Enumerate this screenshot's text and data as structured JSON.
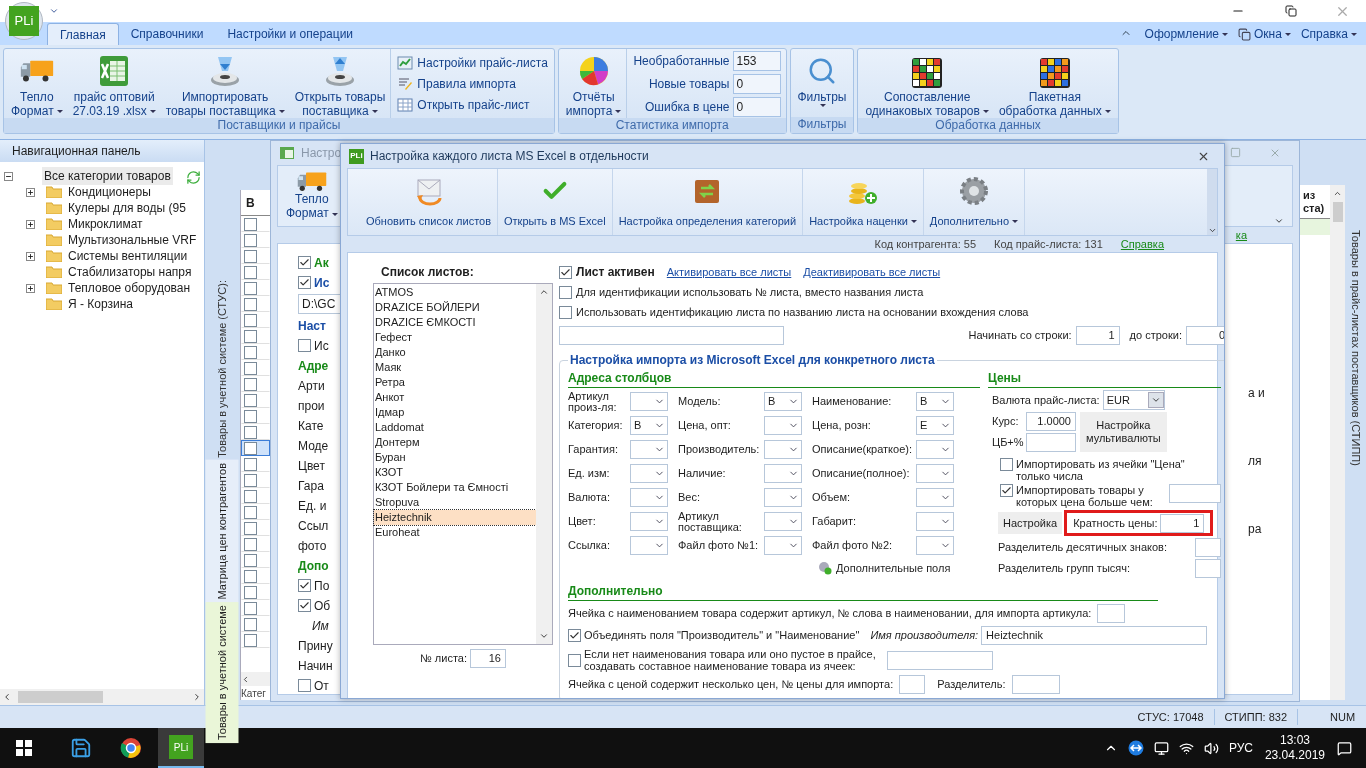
{
  "app": {
    "logo": "PLi"
  },
  "ribbon": {
    "tabs": [
      {
        "label": "Главная",
        "selected": true
      },
      {
        "label": "Справочники",
        "selected": false
      },
      {
        "label": "Настройки и операции",
        "selected": false
      }
    ],
    "right_menu": [
      "Оформление",
      "Окна",
      "Справка"
    ],
    "groups": [
      {
        "title": "Поставщики и прайсы",
        "items": [
          {
            "kind": "large",
            "lines": [
              "Тепло",
              "Формат"
            ]
          },
          {
            "kind": "large",
            "lines": [
              "прайс оптовий",
              "27.03.19  .xlsx"
            ]
          },
          {
            "kind": "large",
            "lines": [
              "Импортировать",
              "товары поставщика"
            ]
          },
          {
            "kind": "large",
            "lines": [
              "Открыть товары",
              "поставщика"
            ]
          },
          {
            "kind": "small",
            "entries": [
              "Настройки прайс-листа",
              "Правила импорта",
              "Открыть прайс-лист"
            ]
          }
        ]
      },
      {
        "title": "Статистика импорта",
        "items": [
          {
            "kind": "large",
            "lines": [
              "Отчёты",
              "импорта"
            ]
          },
          {
            "kind": "stats",
            "rows": [
              {
                "label": "Необработанные",
                "value": "153"
              },
              {
                "label": "Новые товары",
                "value": "0"
              },
              {
                "label": "Ошибка в цене",
                "value": "0"
              }
            ]
          }
        ]
      },
      {
        "title": "Фильтры",
        "items": [
          {
            "kind": "large",
            "lines": [
              "Фильтры"
            ]
          }
        ]
      },
      {
        "title": "Обработка данных",
        "items": [
          {
            "kind": "large",
            "lines": [
              "Сопоставление",
              "одинаковых товаров"
            ]
          },
          {
            "kind": "large",
            "lines": [
              "Пакетная",
              "обработка данных"
            ]
          }
        ]
      }
    ]
  },
  "nav": {
    "title": "Навигационная панель",
    "tree": [
      {
        "label": "Все категории товаров",
        "kind": "group",
        "expanded": true,
        "selected": true,
        "children": [
          {
            "label": "Кондиционеры",
            "kind": "group",
            "expanded": false,
            "selected": false
          },
          {
            "label": "Кулеры для воды (95",
            "kind": "leaf",
            "selected": false
          },
          {
            "label": "Микроклимат",
            "kind": "group",
            "expanded": false,
            "selected": false
          },
          {
            "label": "Мультизональные VRF",
            "kind": "leaf",
            "selected": false
          },
          {
            "label": "Системы вентиляции",
            "kind": "group",
            "expanded": false,
            "selected": false
          },
          {
            "label": "Стабилизаторы напря",
            "kind": "leaf",
            "selected": false
          },
          {
            "label": "Тепловое оборудован",
            "kind": "group",
            "expanded": false,
            "selected": false
          },
          {
            "label": "Я - Корзина",
            "kind": "leaf",
            "selected": false
          }
        ]
      }
    ]
  },
  "side_tabs": {
    "caption": "Товары в учетной системе (СТУС):",
    "tabs": [
      {
        "label": "Матрица цен контрагентов",
        "selected": false
      },
      {
        "label": "Товары в учетной системе",
        "selected": true
      }
    ]
  },
  "grid": {
    "header": "В",
    "footer": "Катег",
    "rows": [
      {
        "checked": false,
        "selected": false
      },
      {
        "checked": false,
        "selected": false
      },
      {
        "checked": false,
        "selected": false
      },
      {
        "checked": false,
        "selected": false
      },
      {
        "checked": false,
        "selected": false
      },
      {
        "checked": false,
        "selected": false
      },
      {
        "checked": false,
        "selected": false
      },
      {
        "checked": false,
        "selected": false
      },
      {
        "checked": false,
        "selected": false
      },
      {
        "checked": false,
        "selected": false
      },
      {
        "checked": false,
        "selected": false
      },
      {
        "checked": false,
        "selected": false
      },
      {
        "checked": false,
        "selected": false
      },
      {
        "checked": false,
        "selected": false
      },
      {
        "checked": false,
        "selected": true
      },
      {
        "checked": false,
        "selected": false
      },
      {
        "checked": false,
        "selected": false
      },
      {
        "checked": false,
        "selected": false
      },
      {
        "checked": false,
        "selected": false
      },
      {
        "checked": false,
        "selected": false
      },
      {
        "checked": false,
        "selected": false
      },
      {
        "checked": false,
        "selected": false
      },
      {
        "checked": false,
        "selected": false
      },
      {
        "checked": false,
        "selected": false
      },
      {
        "checked": false,
        "selected": false
      },
      {
        "checked": false,
        "selected": false
      },
      {
        "checked": false,
        "selected": false
      }
    ]
  },
  "right_panel": {
    "caption": "Товары в прайс-листах поставщиков (СТИПП)",
    "header_lines": [
      "из",
      "ста)"
    ]
  },
  "back_window": {
    "title": "Настро",
    "toolbar_lines": [
      "Тепло",
      "Формат"
    ],
    "right_link": "ка",
    "fragments": [
      {
        "kind": "check",
        "text": "Ак",
        "checked": true,
        "color": "#188a18"
      },
      {
        "kind": "check",
        "text": "Ис",
        "checked": true,
        "color": "#1b4ea6"
      },
      {
        "kind": "field",
        "text": "D:\\GC"
      },
      {
        "kind": "heading",
        "text": "Наст",
        "color": "#1b4ea6"
      },
      {
        "kind": "check",
        "text": "Ис",
        "checked": false
      },
      {
        "kind": "heading",
        "text": "Адре",
        "color": "#188a18"
      },
      {
        "kind": "text",
        "text": "Арти"
      },
      {
        "kind": "text",
        "text": "прои"
      },
      {
        "kind": "text",
        "text": "Кате"
      },
      {
        "kind": "text",
        "text": "Моде"
      },
      {
        "kind": "text",
        "text": "Цвет"
      },
      {
        "kind": "text",
        "text": "Гара"
      },
      {
        "kind": "text",
        "text": "Ед. и"
      },
      {
        "kind": "text",
        "text": "Ссыл"
      },
      {
        "kind": "text",
        "text": "фото"
      },
      {
        "kind": "heading",
        "text": "Допо",
        "color": "#188a18"
      },
      {
        "kind": "check",
        "text": "По",
        "checked": true
      },
      {
        "kind": "check",
        "text": "Об",
        "checked": true
      },
      {
        "kind": "italic",
        "text": "Им"
      },
      {
        "kind": "text",
        "text": "Прину"
      },
      {
        "kind": "text",
        "text": "Начин"
      },
      {
        "kind": "check",
        "text": "От",
        "checked": false
      }
    ],
    "right_fragments": [
      "а и",
      "ля",
      "ра"
    ]
  },
  "dialog": {
    "logo": "PLi",
    "title": "Настройка каждого листа MS Excel в отдельности",
    "toolbar": [
      {
        "label": "Обновить список листов",
        "dropdown": false
      },
      {
        "label": "Открыть в MS Excel",
        "dropdown": false
      },
      {
        "label": "Настройка определения категорий",
        "dropdown": false
      },
      {
        "label": "Настройка наценки",
        "dropdown": true
      },
      {
        "label": "Дополнительно",
        "dropdown": true
      }
    ],
    "info": [
      "Код контрагента: 55",
      "Код прайс-листа: 131"
    ],
    "help_link": "Справка",
    "sheets": {
      "title": "Список листов:",
      "items": [
        {
          "label": "ATMOS",
          "selected": false
        },
        {
          "label": "DRAZICE БОЙЛЕРИ",
          "selected": false
        },
        {
          "label": "DRAZICE ЄМКОСТІ",
          "selected": false
        },
        {
          "label": "Гефест",
          "selected": false
        },
        {
          "label": "Данко",
          "selected": false
        },
        {
          "label": "Маяк",
          "selected": false
        },
        {
          "label": "Ретра",
          "selected": false
        },
        {
          "label": "Анкот",
          "selected": false
        },
        {
          "label": "Ідмар",
          "selected": false
        },
        {
          "label": "Laddomat",
          "selected": false
        },
        {
          "label": "Донтерм",
          "selected": false
        },
        {
          "label": "Буран",
          "selected": false
        },
        {
          "label": "КЗОТ",
          "selected": false
        },
        {
          "label": "КЗОТ Бойлери та Ємності",
          "selected": false
        },
        {
          "label": "Stropuva",
          "selected": false
        },
        {
          "label": "Heiztechnik",
          "selected": true
        },
        {
          "label": "Euroheat",
          "selected": false
        }
      ],
      "number_label": "№ листа:",
      "number": "16"
    },
    "active": {
      "label": "Лист активен",
      "checked": true
    },
    "links": [
      "Активировать все листы",
      "Деактивировать все листы"
    ],
    "options": [
      {
        "label": "Для идентификации использовать № листа, вместо названия листа",
        "checked": false
      },
      {
        "label": "Использовать идентификацию листа по названию листа на основании вхождения слова",
        "checked": false
      }
    ],
    "start_row": {
      "label": "Начинать со строки:",
      "value": "1"
    },
    "end_row": {
      "label": "до строки:",
      "value": "0"
    },
    "import_section": "Настройка импорта из Microsoft Excel для конкретного листа",
    "address_title": "Адреса столбцов",
    "address_columns": [
      [
        {
          "label": "Артикул произ-ля:"
        },
        {
          "label": "Категория:",
          "value": "B"
        },
        {
          "label": "Гарантия:"
        },
        {
          "label": "Ед. изм:"
        },
        {
          "label": "Валюта:"
        },
        {
          "label": "Цвет:"
        },
        {
          "label": "Ссылка:"
        }
      ],
      [
        {
          "label": "Модель:",
          "value": "B"
        },
        {
          "label": "Цена, опт:"
        },
        {
          "label": "Производитель:"
        },
        {
          "label": "Наличие:"
        },
        {
          "label": "Вес:"
        },
        {
          "label": "Артикул поставщика:"
        },
        {
          "label": "Файл фото №1:"
        }
      ],
      [
        {
          "label": "Наименование:",
          "value": "B"
        },
        {
          "label": "Цена, розн:",
          "value": "E"
        },
        {
          "label": "Описание(краткое):"
        },
        {
          "label": "Описание(полное):"
        },
        {
          "label": "Объем:"
        },
        {
          "label": "Габарит:"
        },
        {
          "label": "Файл фото №2:"
        }
      ]
    ],
    "extra_fields": "Дополнительные поля",
    "prices": {
      "title": "Цены",
      "currency_label": "Валюта прайс-листа:",
      "currency": "EUR",
      "rate_label": "Курс:",
      "rate": "1.0000",
      "cb_label": "ЦБ+%",
      "multi_button": [
        "Настройка",
        "мультивалюты"
      ],
      "only_numbers": {
        "label": "Импортировать из ячейки \"Цена\" только числа",
        "checked": false
      },
      "min_price": {
        "label": "Импортировать товары у которых цена больше чем:",
        "checked": true
      },
      "settings_button": "Настройка",
      "multiplicity": {
        "label": "Кратность цены:",
        "value": "1",
        "highlighted": true
      },
      "decimal_sep": "Разделитель десятичных знаков:",
      "group_sep": "Разделитель групп тысяч:"
    },
    "extra": {
      "title": "Дополнительно",
      "article_cell": "Ячейка с наименованием товара содержит артикул, № слова в наименовании, для импорта артикула:",
      "merge": {
        "label": "Объединять поля \"Производитель\" и \"Наименование\"",
        "checked": true
      },
      "maker_label": "Имя производителя:",
      "maker": "Heiztechnik",
      "compose": {
        "label": "Если нет наименования товара или оно пустое в прайсе, создавать составное наименование товара из ячеек:",
        "checked": false
      },
      "multi_price": "Ячейка с ценой содержит несколько цен, № цены для импорта:",
      "separator": "Разделитель:"
    }
  },
  "status_bar": [
    "СТУС: 17048",
    "СТИПП: 832"
  ],
  "status_num": "NUM",
  "taskbar": {
    "app_badge": "PLi",
    "language": "РУС",
    "time": "13:03",
    "date": "23.04.2019"
  }
}
